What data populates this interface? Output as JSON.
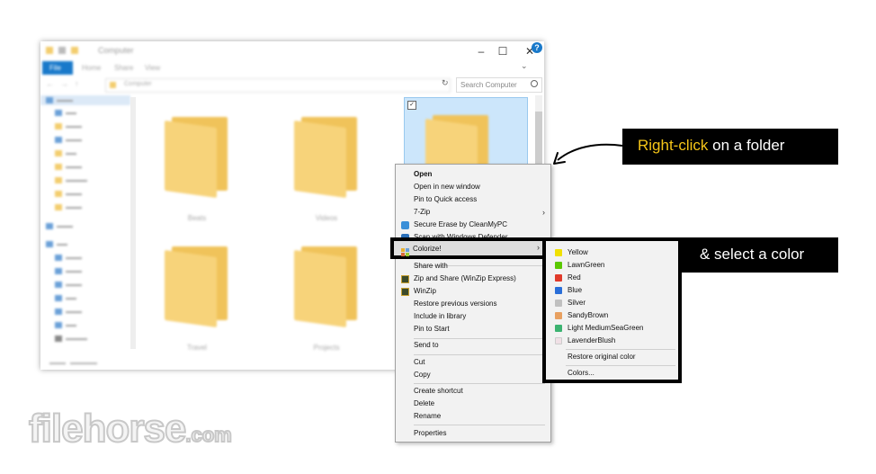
{
  "explorer": {
    "title": "Computer",
    "ribbon_tabs": [
      "File",
      "Home",
      "Share",
      "View"
    ],
    "address": "Computer",
    "search_placeholder": "Search Computer",
    "folders": [
      {
        "label": "Beats"
      },
      {
        "label": "Videos"
      },
      {
        "label": ""
      },
      {
        "label": "Travel"
      },
      {
        "label": "Projects"
      }
    ]
  },
  "context_menu": {
    "items": [
      {
        "label": "Open",
        "bold": true
      },
      {
        "label": "Open in new window"
      },
      {
        "label": "Pin to Quick access"
      },
      {
        "label": "7-Zip",
        "submenu": true
      },
      {
        "label": "Secure Erase by CleanMyPC"
      },
      {
        "label": "Scan with Windows Defender..."
      },
      {
        "label": "Colorize!",
        "submenu": true,
        "highlighted": true
      },
      {
        "label": "Share with",
        "submenu": true
      },
      {
        "label": "Zip and Share (WinZip Express)"
      },
      {
        "label": "WinZip",
        "submenu": true
      },
      {
        "label": "Restore previous versions"
      },
      {
        "label": "Include in library",
        "submenu": true
      },
      {
        "label": "Pin to Start"
      },
      {
        "label": "Send to",
        "submenu": true
      },
      {
        "label": "Cut"
      },
      {
        "label": "Copy"
      },
      {
        "label": "Create shortcut"
      },
      {
        "label": "Delete"
      },
      {
        "label": "Rename"
      },
      {
        "label": "Properties"
      }
    ]
  },
  "color_submenu": {
    "colors": [
      {
        "label": "Yellow",
        "color": "#f0e000"
      },
      {
        "label": "LawnGreen",
        "color": "#5ac800"
      },
      {
        "label": "Red",
        "color": "#e03a2a"
      },
      {
        "label": "Blue",
        "color": "#2a6ed8"
      },
      {
        "label": "Silver",
        "color": "#c0c0c0"
      },
      {
        "label": "SandyBrown",
        "color": "#e8a060"
      },
      {
        "label": "Light MediumSeaGreen",
        "color": "#3cb371"
      },
      {
        "label": "LavenderBlush",
        "color": "#f0e0e6"
      }
    ],
    "restore_label": "Restore original color",
    "colors_label": "Colors..."
  },
  "callouts": {
    "right_click_accent": "Right-click",
    "right_click_rest": " on a folder",
    "select_color": "& select a color"
  },
  "logo": {
    "main": "filehorse",
    "suffix": ".com"
  },
  "accent_color": "#f5c518"
}
